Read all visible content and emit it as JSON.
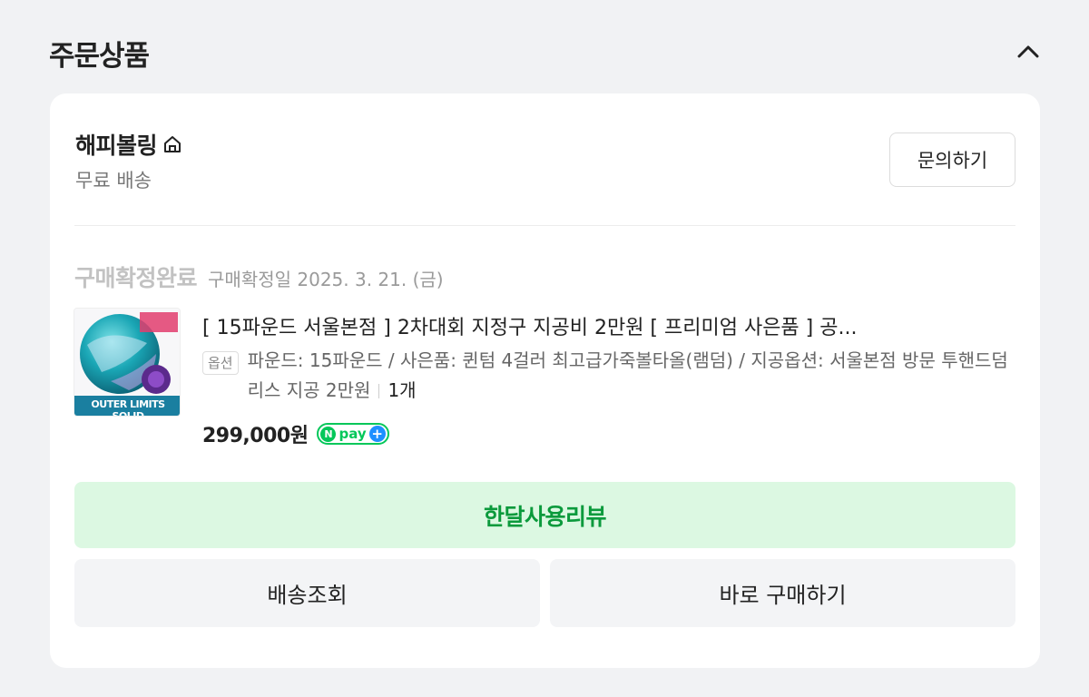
{
  "section": {
    "title": "주문상품",
    "collapse_icon": "chevron-up-icon"
  },
  "store": {
    "name": "해피볼링",
    "home_icon": "home-icon",
    "shipping": "무료 배송",
    "inquiry_label": "문의하기"
  },
  "order": {
    "status": "구매확정완료",
    "status_date": "구매확정일 2025. 3. 21. (금)"
  },
  "product": {
    "thumbnail_label": "OUTER LIMITS SOLID",
    "title": "[ 15파운드 서울본점 ] 2차대회 지정구 지공비 2만원 [ 프리미엄 사은품 ] 공...",
    "option_badge": "옵션",
    "option_text": "파운드: 15파운드 / 사은품: 퀸텀 4걸러 최고급가죽볼타올(램덤) / 지공옵션: 서울본점 방문 투핸드덤리스 지공 2만원",
    "quantity": "1개",
    "price": "299,000원",
    "npay_text": "pay",
    "npay_n": "N",
    "npay_plus": "+"
  },
  "actions": {
    "review_label": "한달사용리뷰",
    "tracking_label": "배송조회",
    "buy_again_label": "바로 구매하기"
  },
  "colors": {
    "review_bg": "#dcf8e2",
    "review_text": "#0b9a3c",
    "npay_green": "#03c75a",
    "plus_blue": "#1e90ff"
  }
}
